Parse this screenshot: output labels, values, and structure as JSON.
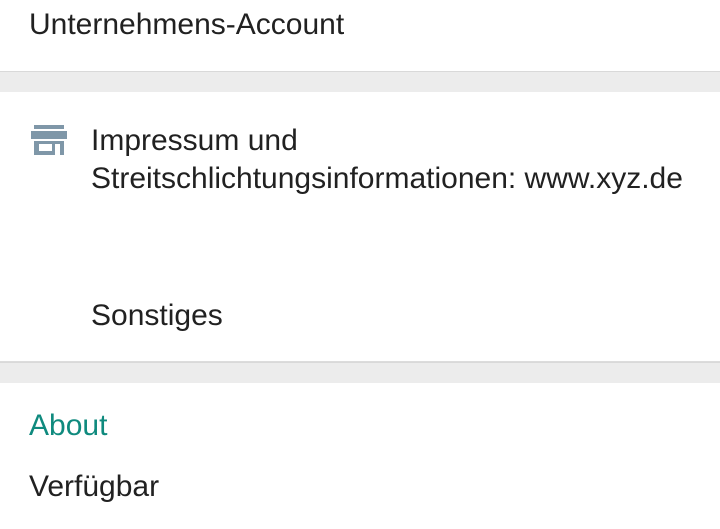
{
  "account": {
    "label": "Unternehmens-Account"
  },
  "info": {
    "impressum": {
      "icon": "store-icon",
      "text": "Impressum und Streitschlichtungsinformationen: www.xyz.de"
    },
    "other": {
      "icon": "shapes-icon",
      "text": "Sonstiges"
    }
  },
  "about": {
    "header": "About",
    "value": "Verfügbar"
  },
  "colors": {
    "accent": "#0f8a7e",
    "icon": "#7f97a8",
    "separator": "#ececec"
  }
}
